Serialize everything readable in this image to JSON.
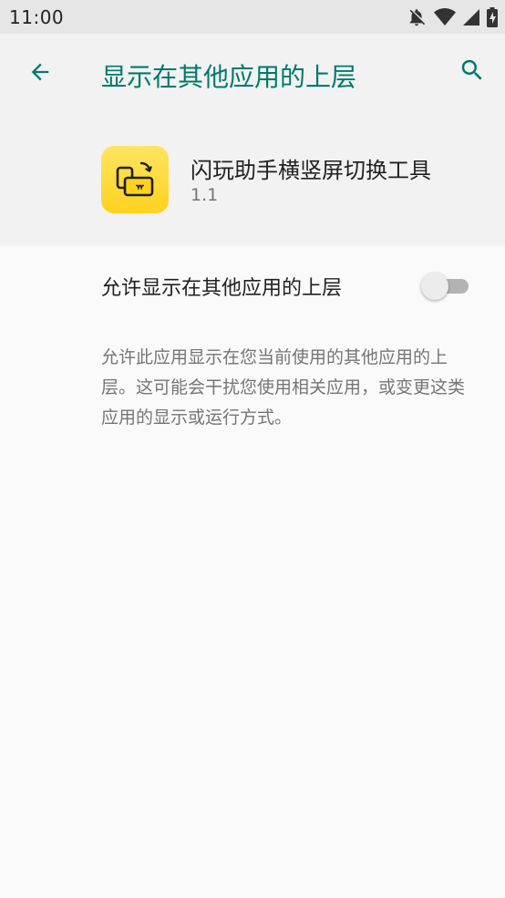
{
  "status_bar": {
    "time": "11:00",
    "icons": [
      "notifications-off-icon",
      "wifi-icon",
      "signal-icon",
      "battery-charging-icon"
    ]
  },
  "app_bar": {
    "title": "显示在其他应用的上层",
    "back_icon": "arrow-back-icon",
    "search_icon": "search-icon"
  },
  "app_info": {
    "name": "闪玩助手横竖屏切换工具",
    "version": "1.1",
    "icon": "rotate-screen-app-icon"
  },
  "setting": {
    "label": "允许显示在其他应用的上层",
    "enabled": false
  },
  "description": "允许此应用显示在您当前使用的其他应用的上层。这可能会干扰您使用相关应用，或变更这类应用的显示或运行方式。",
  "colors": {
    "accent": "#00796b",
    "app_icon_bg": "#ffd21e"
  }
}
